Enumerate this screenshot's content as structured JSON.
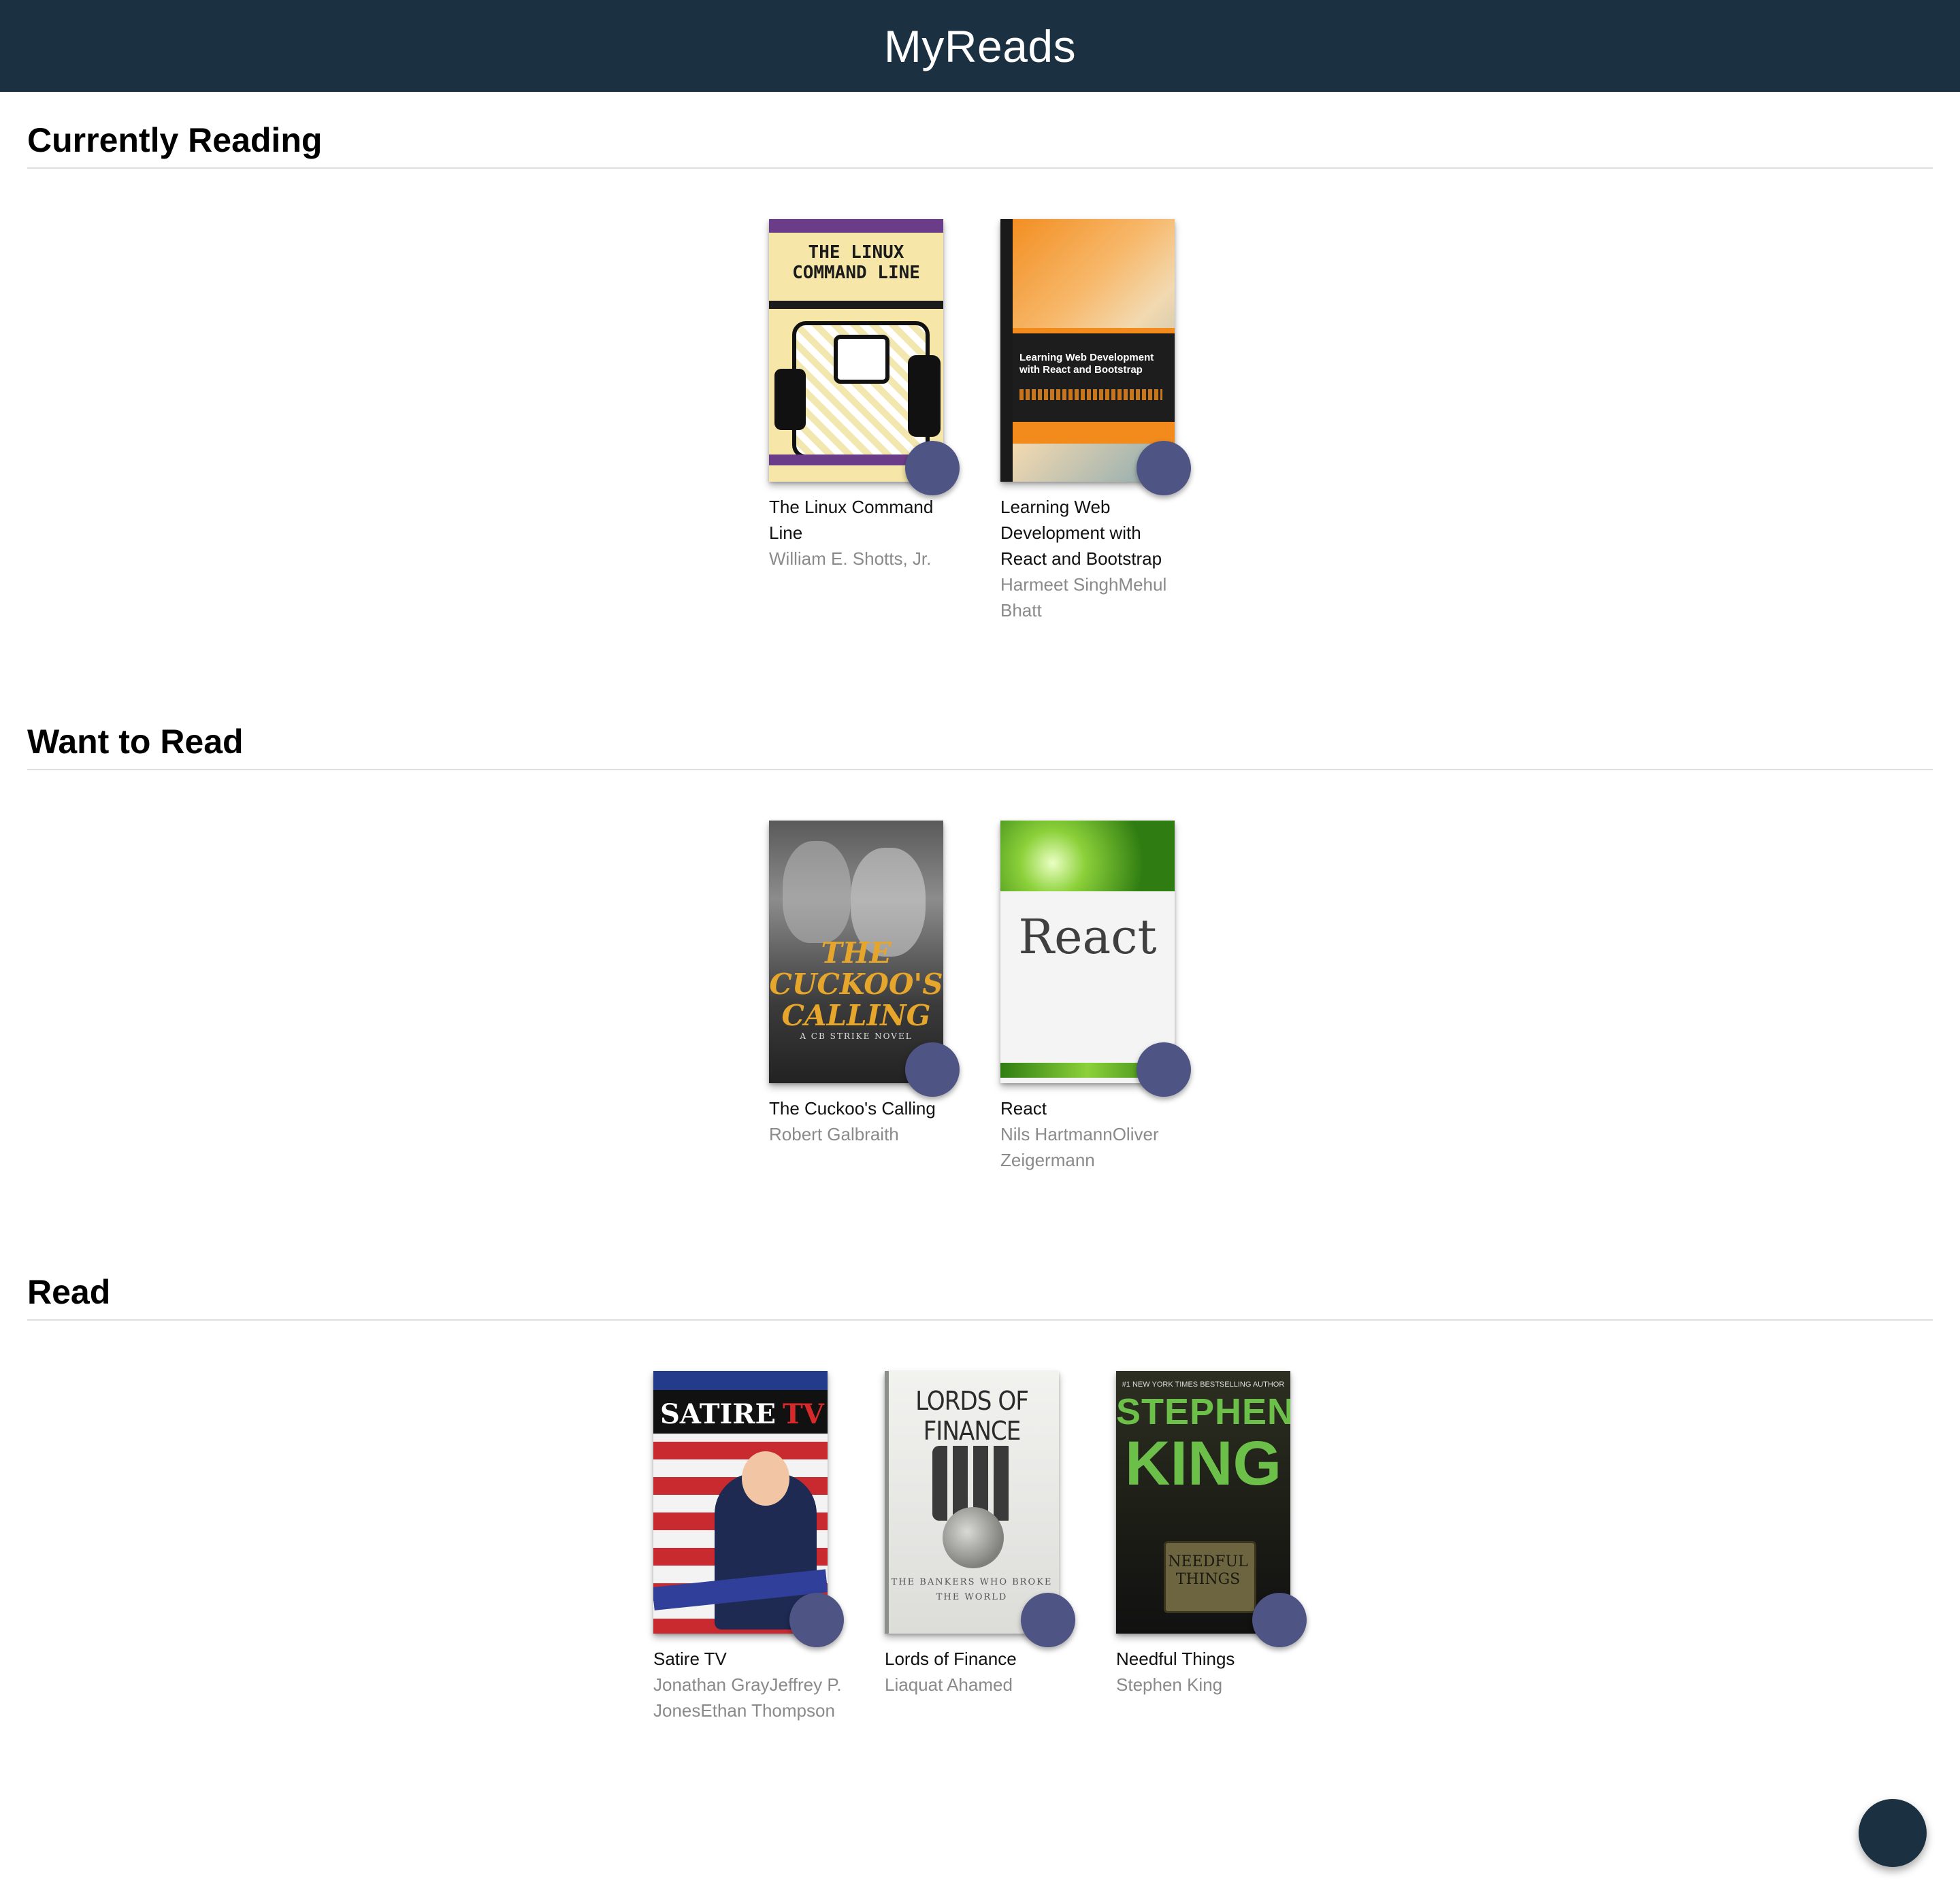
{
  "header": {
    "title": "MyReads"
  },
  "shelves": [
    {
      "title": "Currently Reading",
      "books": [
        {
          "title": "The Linux Command Line",
          "authors": "William E. Shotts, Jr.",
          "cover_text": "THE LINUX COMMAND LINE"
        },
        {
          "title": "Learning Web Development with React and Bootstrap",
          "authors": "Harmeet SinghMehul Bhatt",
          "cover_text": "Learning Web Development with React and Bootstrap"
        }
      ]
    },
    {
      "title": "Want to Read",
      "books": [
        {
          "title": "The Cuckoo's Calling",
          "authors": "Robert Galbraith",
          "cover_text": "THE CUCKOO'S CALLING",
          "cover_sub": "A CB STRIKE NOVEL"
        },
        {
          "title": "React",
          "authors": "Nils HartmannOliver Zeigermann",
          "cover_text": "React"
        }
      ]
    },
    {
      "title": "Read",
      "books": [
        {
          "title": "Satire TV",
          "authors": "Jonathan GrayJeffrey P. JonesEthan Thompson",
          "cover_text_a": "SATIRE",
          "cover_text_b": "TV"
        },
        {
          "title": "Lords of Finance",
          "authors": "Liaquat Ahamed",
          "cover_text": "LORDS OF FINANCE",
          "cover_sub": "THE BANKERS WHO BROKE THE WORLD"
        },
        {
          "title": "Needful Things",
          "authors": "Stephen King",
          "cover_top": "#1 NEW YORK TIMES BESTSELLING AUTHOR",
          "cover_text_a": "STEPHEN",
          "cover_text_b": "KING",
          "cover_sign": "NEEDFUL THINGS"
        }
      ]
    }
  ],
  "colors": {
    "header_bg": "#1b3040",
    "shelf_changer": "#4e5484",
    "author_text": "#8a8a8a"
  },
  "icons": {
    "shelf_changer": "shelf-changer-icon",
    "open_search": "add-icon"
  }
}
